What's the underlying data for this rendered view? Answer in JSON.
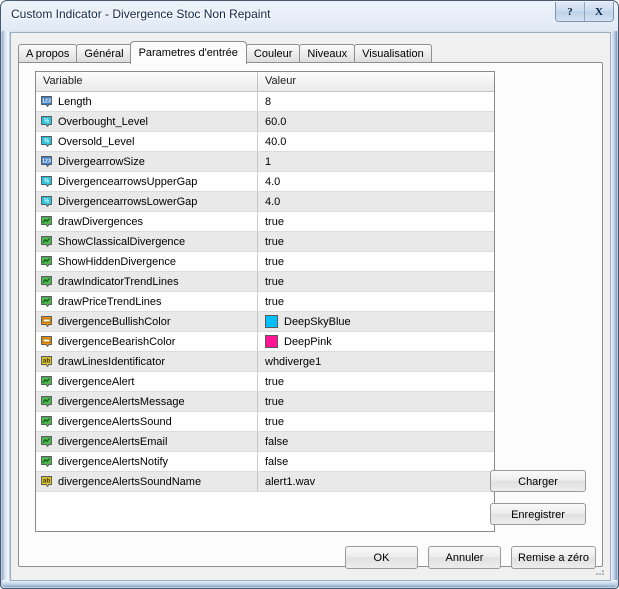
{
  "window": {
    "title": "Custom Indicator - Divergence Stoc Non Repaint",
    "help_button": "?",
    "close_button": "X"
  },
  "tabs": [
    {
      "label": "A propos",
      "active": false
    },
    {
      "label": "Général",
      "active": false
    },
    {
      "label": "Parametres d'entrée",
      "active": true
    },
    {
      "label": "Couleur",
      "active": false
    },
    {
      "label": "Niveaux",
      "active": false
    },
    {
      "label": "Visualisation",
      "active": false
    }
  ],
  "grid": {
    "columns": [
      "Variable",
      "Valeur"
    ],
    "rows": [
      {
        "icon": "int-icon",
        "variable": "Length",
        "value": "8"
      },
      {
        "icon": "double-icon",
        "variable": "Overbought_Level",
        "value": "60.0"
      },
      {
        "icon": "double-icon",
        "variable": "Oversold_Level",
        "value": "40.0"
      },
      {
        "icon": "int-icon",
        "variable": "DivergearrowSize",
        "value": "1"
      },
      {
        "icon": "double-icon",
        "variable": "DivergencearrowsUpperGap",
        "value": "4.0"
      },
      {
        "icon": "double-icon",
        "variable": "DivergencearrowsLowerGap",
        "value": "4.0"
      },
      {
        "icon": "bool-icon",
        "variable": "drawDivergences",
        "value": "true"
      },
      {
        "icon": "bool-icon",
        "variable": "ShowClassicalDivergence",
        "value": "true"
      },
      {
        "icon": "bool-icon",
        "variable": "ShowHiddenDivergence",
        "value": "true"
      },
      {
        "icon": "bool-icon",
        "variable": "drawIndicatorTrendLines",
        "value": "true"
      },
      {
        "icon": "bool-icon",
        "variable": "drawPriceTrendLines",
        "value": "true"
      },
      {
        "icon": "color-icon",
        "variable": "divergenceBullishColor",
        "value": "DeepSkyBlue",
        "swatch": "#00BFFF"
      },
      {
        "icon": "color-icon",
        "variable": "divergenceBearishColor",
        "value": "DeepPink",
        "swatch": "#FF1493"
      },
      {
        "icon": "string-icon",
        "variable": "drawLinesIdentificator",
        "value": "whdiverge1"
      },
      {
        "icon": "bool-icon",
        "variable": "divergenceAlert",
        "value": "true"
      },
      {
        "icon": "bool-icon",
        "variable": "divergenceAlertsMessage",
        "value": "true"
      },
      {
        "icon": "bool-icon",
        "variable": "divergenceAlertsSound",
        "value": "true"
      },
      {
        "icon": "bool-icon",
        "variable": "divergenceAlertsEmail",
        "value": "false"
      },
      {
        "icon": "bool-icon",
        "variable": "divergenceAlertsNotify",
        "value": "false"
      },
      {
        "icon": "string-icon",
        "variable": "divergenceAlertsSoundName",
        "value": "alert1.wav"
      }
    ]
  },
  "side_buttons": {
    "load": "Charger",
    "save": "Enregistrer"
  },
  "dialog_buttons": {
    "ok": "OK",
    "cancel": "Annuler",
    "reset": "Remise a zéro"
  },
  "colors": {
    "deep_sky_blue": "#00BFFF",
    "deep_pink": "#FF1493",
    "int_icon": "#3f7fc8",
    "double_icon": "#2fc3d8",
    "bool_icon": "#52b552",
    "color_icon": "#f0920e",
    "string_icon": "#d9c02b"
  }
}
